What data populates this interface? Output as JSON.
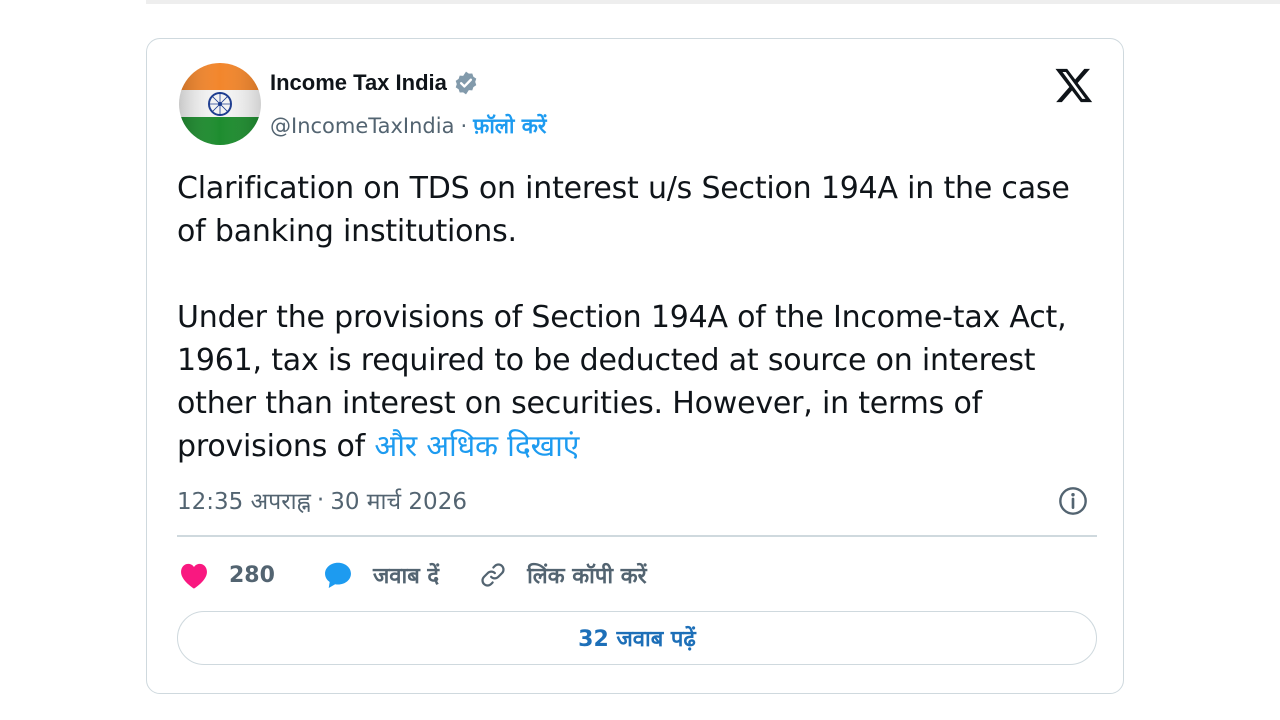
{
  "tweet": {
    "author_name": "Income Tax India",
    "handle": "@IncomeTaxIndia",
    "separator": "·",
    "follow_label": "फ़ॉलो करें",
    "paragraph1": "Clarification on TDS on interest u/s Section 194A in the case of banking institutions.",
    "paragraph2": "Under the provisions of Section 194A of the Income-tax Act, 1961, tax is required to be deducted at source on interest other than interest on securities. However, in terms of provisions of",
    "show_more": "और अधिक दिखाएं",
    "time": "12:35 अपराह्न",
    "date": "30 मार्च 2026"
  },
  "actions": {
    "likes_count": "280",
    "reply_label": "जवाब दें",
    "copy_link_label": "लिंक कॉपी करें",
    "read_replies_label": "32 जवाब पढ़ें"
  },
  "icons": {
    "avatar": "india-flag-avatar",
    "verified": "verified-badge-icon",
    "x_logo": "x-logo-icon",
    "info": "info-icon",
    "like": "heart-icon",
    "reply": "reply-bubble-icon",
    "link": "link-icon"
  },
  "colors": {
    "accent": "#1d9bf0",
    "heart": "#f91880",
    "text": "#0f1419",
    "muted": "#536471",
    "border": "#cfd9de"
  }
}
